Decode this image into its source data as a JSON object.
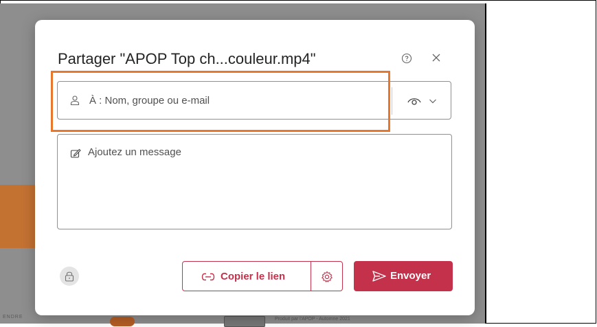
{
  "dialog": {
    "title": "Partager \"APOP Top ch...couleur.mp4\"",
    "to_placeholder": "À : Nom, groupe ou e-mail",
    "message_placeholder": "Ajoutez un message",
    "copy_link_label": "Copier le lien",
    "send_label": "Envoyer"
  },
  "background": {
    "footer_left": "ENDRE",
    "credit": "Produit par l'APOP - Automne 2021"
  },
  "colors": {
    "accent": "#c4314b",
    "highlight": "#e8772b",
    "backdrop": "#8e8e8e"
  },
  "icons": [
    "help-icon",
    "close-icon",
    "person-icon",
    "eye-icon",
    "chevron-down-icon",
    "pen-icon",
    "lock-icon",
    "link-icon",
    "gear-icon",
    "send-icon"
  ]
}
